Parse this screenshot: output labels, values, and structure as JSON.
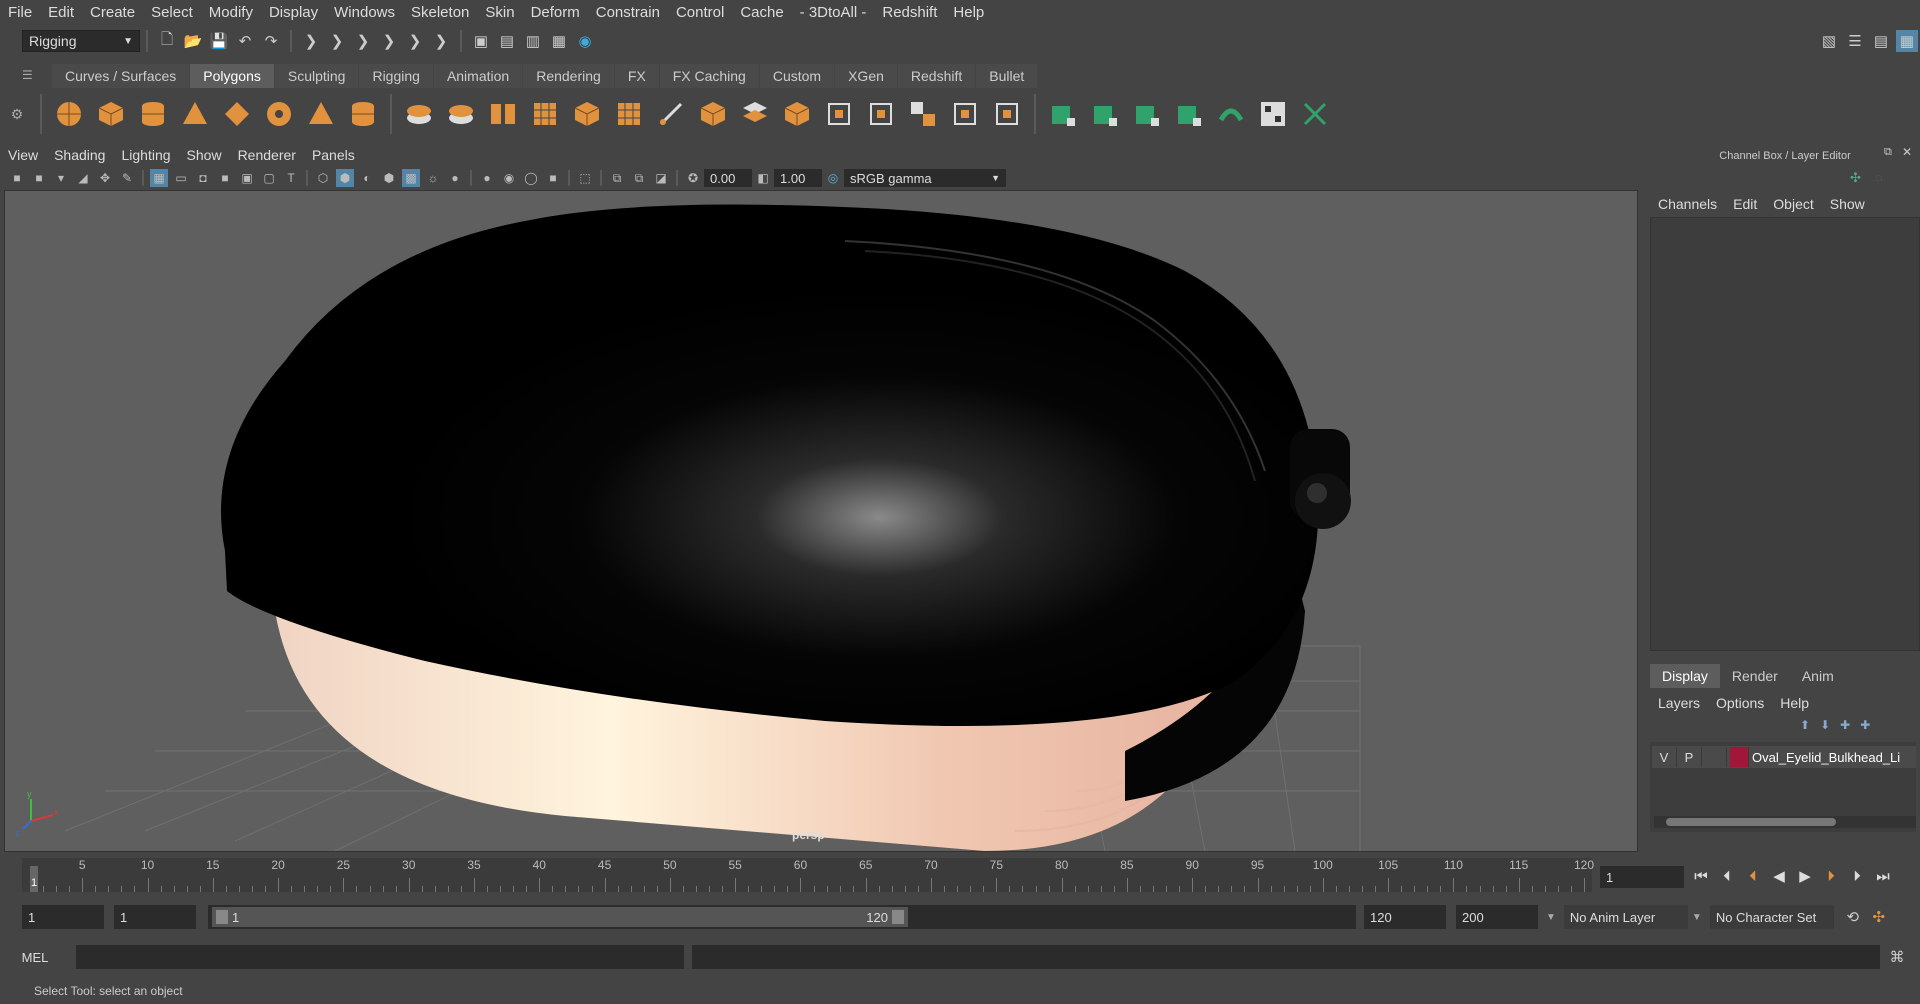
{
  "menubar": [
    "File",
    "Edit",
    "Create",
    "Select",
    "Modify",
    "Display",
    "Windows",
    "Skeleton",
    "Skin",
    "Deform",
    "Constrain",
    "Control",
    "Cache",
    "- 3DtoAll -",
    "Redshift",
    "Help"
  ],
  "statusline": {
    "mode": "Rigging"
  },
  "shelf_tabs": [
    {
      "label": "Curves / Surfaces",
      "active": false
    },
    {
      "label": "Polygons",
      "active": true
    },
    {
      "label": "Sculpting",
      "active": false
    },
    {
      "label": "Rigging",
      "active": false
    },
    {
      "label": "Animation",
      "active": false
    },
    {
      "label": "Rendering",
      "active": false
    },
    {
      "label": "FX",
      "active": false
    },
    {
      "label": "FX Caching",
      "active": false
    },
    {
      "label": "Custom",
      "active": false
    },
    {
      "label": "XGen",
      "active": false
    },
    {
      "label": "Redshift",
      "active": false
    },
    {
      "label": "Bullet",
      "active": false
    }
  ],
  "viewport": {
    "menu": [
      "View",
      "Shading",
      "Lighting",
      "Show",
      "Renderer",
      "Panels"
    ],
    "exposure": "0.00",
    "gamma": "1.00",
    "color_space": "sRGB gamma",
    "camera_label": "persp"
  },
  "channel_box": {
    "title": "Channel Box / Layer Editor",
    "menu": [
      "Channels",
      "Edit",
      "Object",
      "Show"
    ]
  },
  "layer_editor": {
    "tabs": [
      {
        "label": "Display",
        "active": true
      },
      {
        "label": "Render",
        "active": false
      },
      {
        "label": "Anim",
        "active": false
      }
    ],
    "menu": [
      "Layers",
      "Options",
      "Help"
    ],
    "layer": {
      "v": "V",
      "p": "P",
      "name": "Oval_Eyelid_Bulkhead_Li",
      "color": "#a0173a"
    }
  },
  "timeline": {
    "ticks": [
      5,
      10,
      15,
      20,
      25,
      30,
      35,
      40,
      45,
      50,
      55,
      60,
      65,
      70,
      75,
      80,
      85,
      90,
      95,
      100,
      105,
      110,
      115,
      120
    ],
    "current_frame_marker": "1",
    "current_frame": "1",
    "range_start": "1",
    "playback_start": "1",
    "range_slider_start": "1",
    "range_slider_end": "120",
    "playback_end": "120",
    "range_end": "200",
    "anim_layer": "No Anim Layer",
    "character_set": "No Character Set"
  },
  "command_line": {
    "label": "MEL"
  },
  "help_line": "Select Tool: select an object",
  "colors": {
    "accent_blue": "#5285a6",
    "shelf_orange": "#e0923f",
    "shelf_green": "#2fa36b",
    "layer_red": "#a0173a"
  }
}
